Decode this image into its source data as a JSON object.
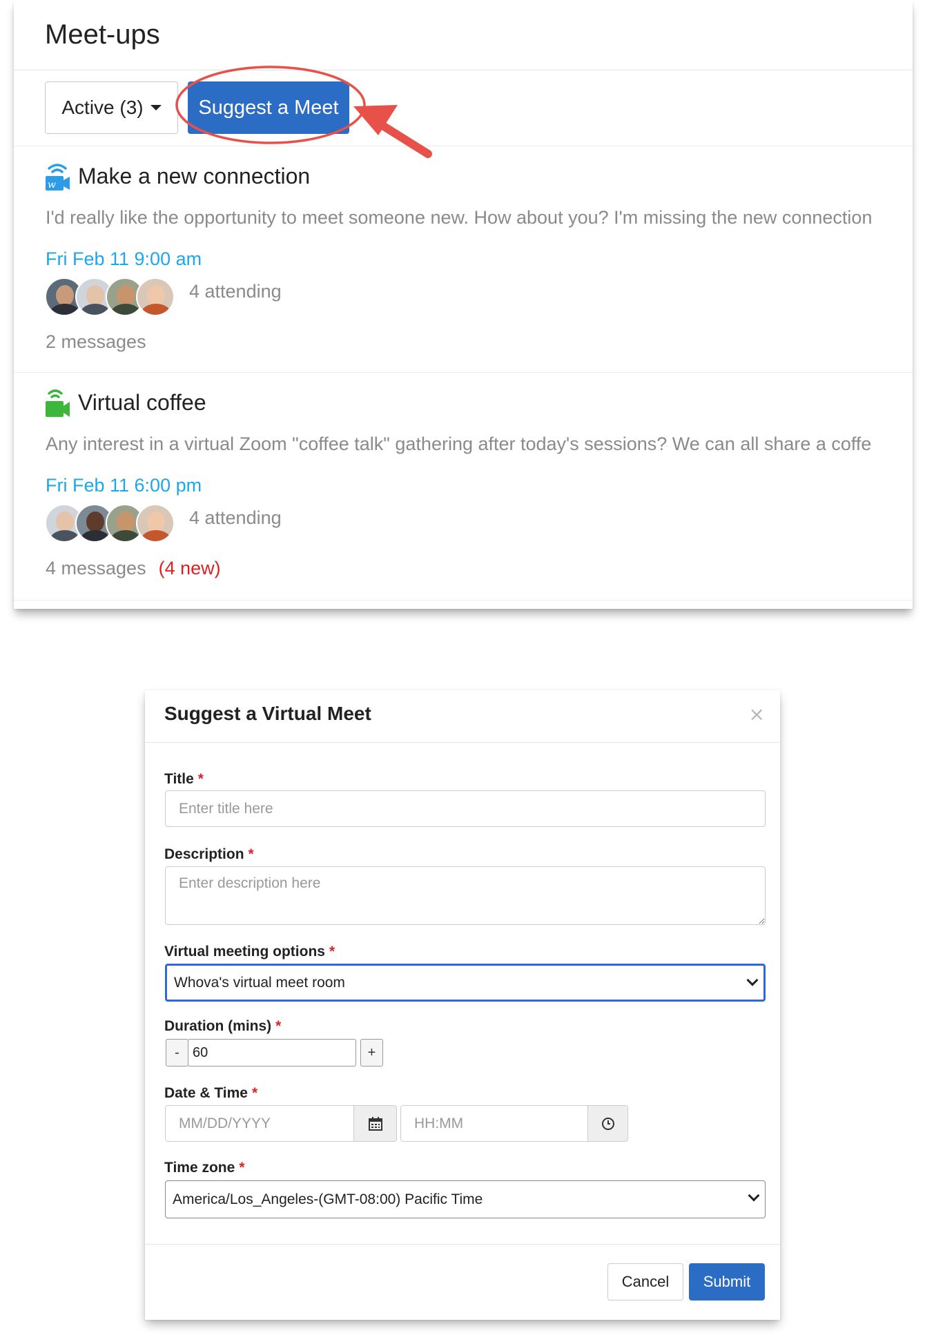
{
  "meetups": {
    "title": "Meet-ups",
    "filter_label": "Active (3)",
    "suggest_label": "Suggest a Meet",
    "annotation_color": "#e8504a",
    "items": [
      {
        "title": "Make a new connection",
        "icon": "whova-video-icon",
        "icon_color": "#2b9ce6",
        "description": "I'd really like the opportunity to meet someone new. How about you? I'm missing the new connection",
        "date": "Fri Feb 11 9:00 am",
        "attending": "4 attending",
        "messages": "2 messages",
        "new_messages": ""
      },
      {
        "title": "Virtual coffee",
        "icon": "zoom-video-icon",
        "icon_color": "#3cb63c",
        "description": "Any interest in a virtual Zoom \"coffee talk\" gathering after today's sessions? We can all share a coffe",
        "date": "Fri Feb 11 6:00 pm",
        "attending": "4 attending",
        "messages": "4 messages",
        "new_messages": "(4 new)"
      }
    ]
  },
  "modal": {
    "title": "Suggest a Virtual Meet",
    "close": "×",
    "required_mark": "*",
    "title_field": {
      "label": "Title",
      "placeholder": "Enter title here"
    },
    "description_field": {
      "label": "Description",
      "placeholder": "Enter description here"
    },
    "virtual_options": {
      "label": "Virtual meeting options",
      "value": "Whova's virtual meet room"
    },
    "duration": {
      "label": "Duration (mins)",
      "value": "60",
      "minus": "-",
      "plus": "+"
    },
    "datetime": {
      "label": "Date & Time",
      "date_placeholder": "MM/DD/YYYY",
      "time_placeholder": "HH:MM"
    },
    "timezone": {
      "label": "Time zone",
      "value": "America/Los_Angeles-(GMT-08:00) Pacific Time"
    },
    "cancel_label": "Cancel",
    "submit_label": "Submit"
  }
}
